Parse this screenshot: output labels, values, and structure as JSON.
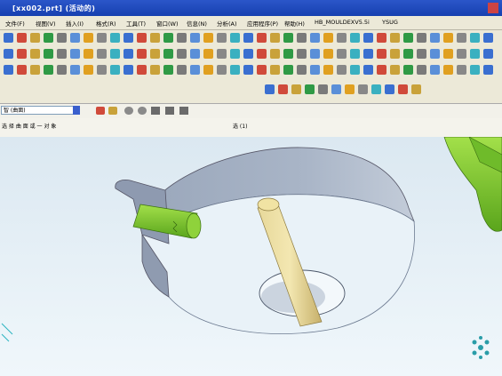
{
  "window": {
    "title": "[xx002.prt] (活动的)"
  },
  "menu": [
    "文件(F)",
    "视图(V)",
    "插入(I)",
    "格式(R)",
    "工具(T)",
    "窗口(W)",
    "信息(N)",
    "分析(A)",
    "应用程序(P)",
    "帮助(H)",
    "HB_MOULDEXV5.5i",
    "YSUG"
  ],
  "command_bar": {
    "filter_value": "智 (曲面)"
  },
  "status": {
    "message": "选 择 曲 面 或 一 对 象",
    "count": "选 (1)"
  },
  "colors": {
    "pin_yellow": "#dcc77d",
    "pin_green": "#7bc62a",
    "viewport_bg": "#eaf5fb",
    "surface_blue": "#a9b5c7"
  }
}
